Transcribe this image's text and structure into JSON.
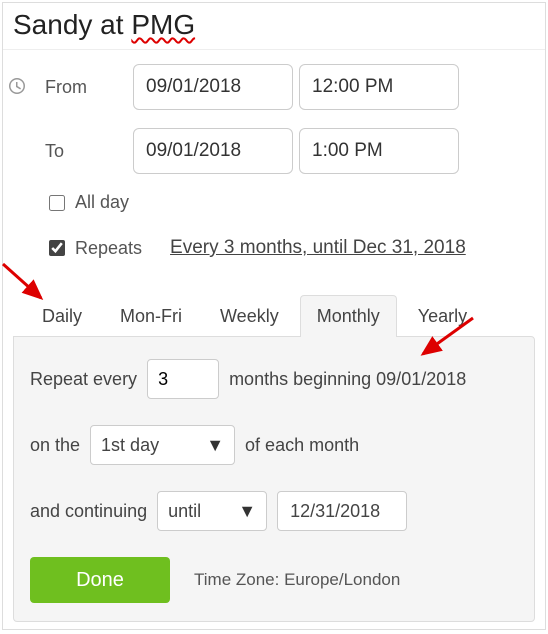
{
  "title_pre": "Sandy at ",
  "title_squiggle": "PMG",
  "from_label": "From",
  "to_label": "To",
  "from_date": "09/01/2018",
  "from_time": "12:00 PM",
  "to_date": "09/01/2018",
  "to_time": "1:00 PM",
  "allday_label": "All day",
  "repeats_label": "Repeats",
  "repeat_summary": "Every 3 months, until Dec 31, 2018",
  "tabs": {
    "daily": "Daily",
    "monfri": "Mon-Fri",
    "weekly": "Weekly",
    "monthly": "Monthly",
    "yearly": "Yearly"
  },
  "repeat_every_pre": "Repeat every",
  "repeat_every_val": "3",
  "repeat_every_post": "months beginning 09/01/2018",
  "onthe_pre": "on the",
  "onthe_val": "1st day",
  "onthe_post": "of each month",
  "cont_pre": "and continuing",
  "cont_mode": "until",
  "cont_date": "12/31/2018",
  "done_label": "Done",
  "tz_label": "Time Zone: Europe/London"
}
